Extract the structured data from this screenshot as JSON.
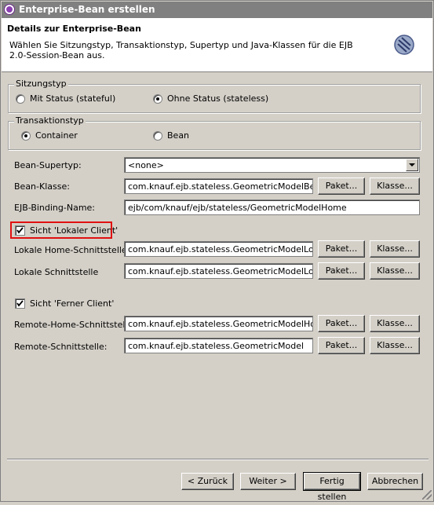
{
  "window": {
    "title": "Enterprise-Bean erstellen"
  },
  "header": {
    "title": "Details zur Enterprise-Bean",
    "description": "Wählen Sie Sitzungstyp, Transaktionstyp, Supertyp und Java-Klassen für die EJB 2.0-Session-Bean aus.",
    "icon": "wizard-bean-icon"
  },
  "session_type": {
    "legend": "Sitzungstyp",
    "options": [
      {
        "label": "Mit Status (stateful)",
        "selected": false
      },
      {
        "label": "Ohne Status (stateless)",
        "selected": true
      }
    ]
  },
  "transaction_type": {
    "legend": "Transaktionstyp",
    "options": [
      {
        "label": "Container",
        "selected": true
      },
      {
        "label": "Bean",
        "selected": false
      }
    ]
  },
  "fields": {
    "supertype_label": "Bean-Supertyp:",
    "supertype_value": "<none>",
    "bean_class_label": "Bean-Klasse:",
    "bean_class_value": "com.knauf.ejb.stateless.GeometricModelBean",
    "binding_label": "EJB-Binding-Name:",
    "binding_value": "ejb/com/knauf/ejb/stateless/GeometricModelHome",
    "local_home_label": "Lokale Home-Schnittstelle:",
    "local_home_value": "com.knauf.ejb.stateless.GeometricModelLocalHo",
    "local_label": "Lokale Schnittstelle",
    "local_value": "com.knauf.ejb.stateless.GeometricModelLocal",
    "remote_home_label": "Remote-Home-Schnittstelle:",
    "remote_home_value": "com.knauf.ejb.stateless.GeometricModelHome",
    "remote_label": "Remote-Schnittstelle:",
    "remote_value": "com.knauf.ejb.stateless.GeometricModel"
  },
  "checks": {
    "local_client": {
      "label": "Sicht 'Lokaler Client'",
      "checked": true
    },
    "remote_client": {
      "label": "Sicht 'Ferner Client'",
      "checked": true
    }
  },
  "buttons": {
    "package": "Paket...",
    "class": "Klasse...",
    "back": "< Zurück",
    "next": "Weiter >",
    "finish": "Fertig stellen",
    "cancel": "Abbrechen"
  },
  "colors": {
    "highlight": "#e01010",
    "title_bar": "#808080",
    "dialog": "#d4d0c8"
  }
}
